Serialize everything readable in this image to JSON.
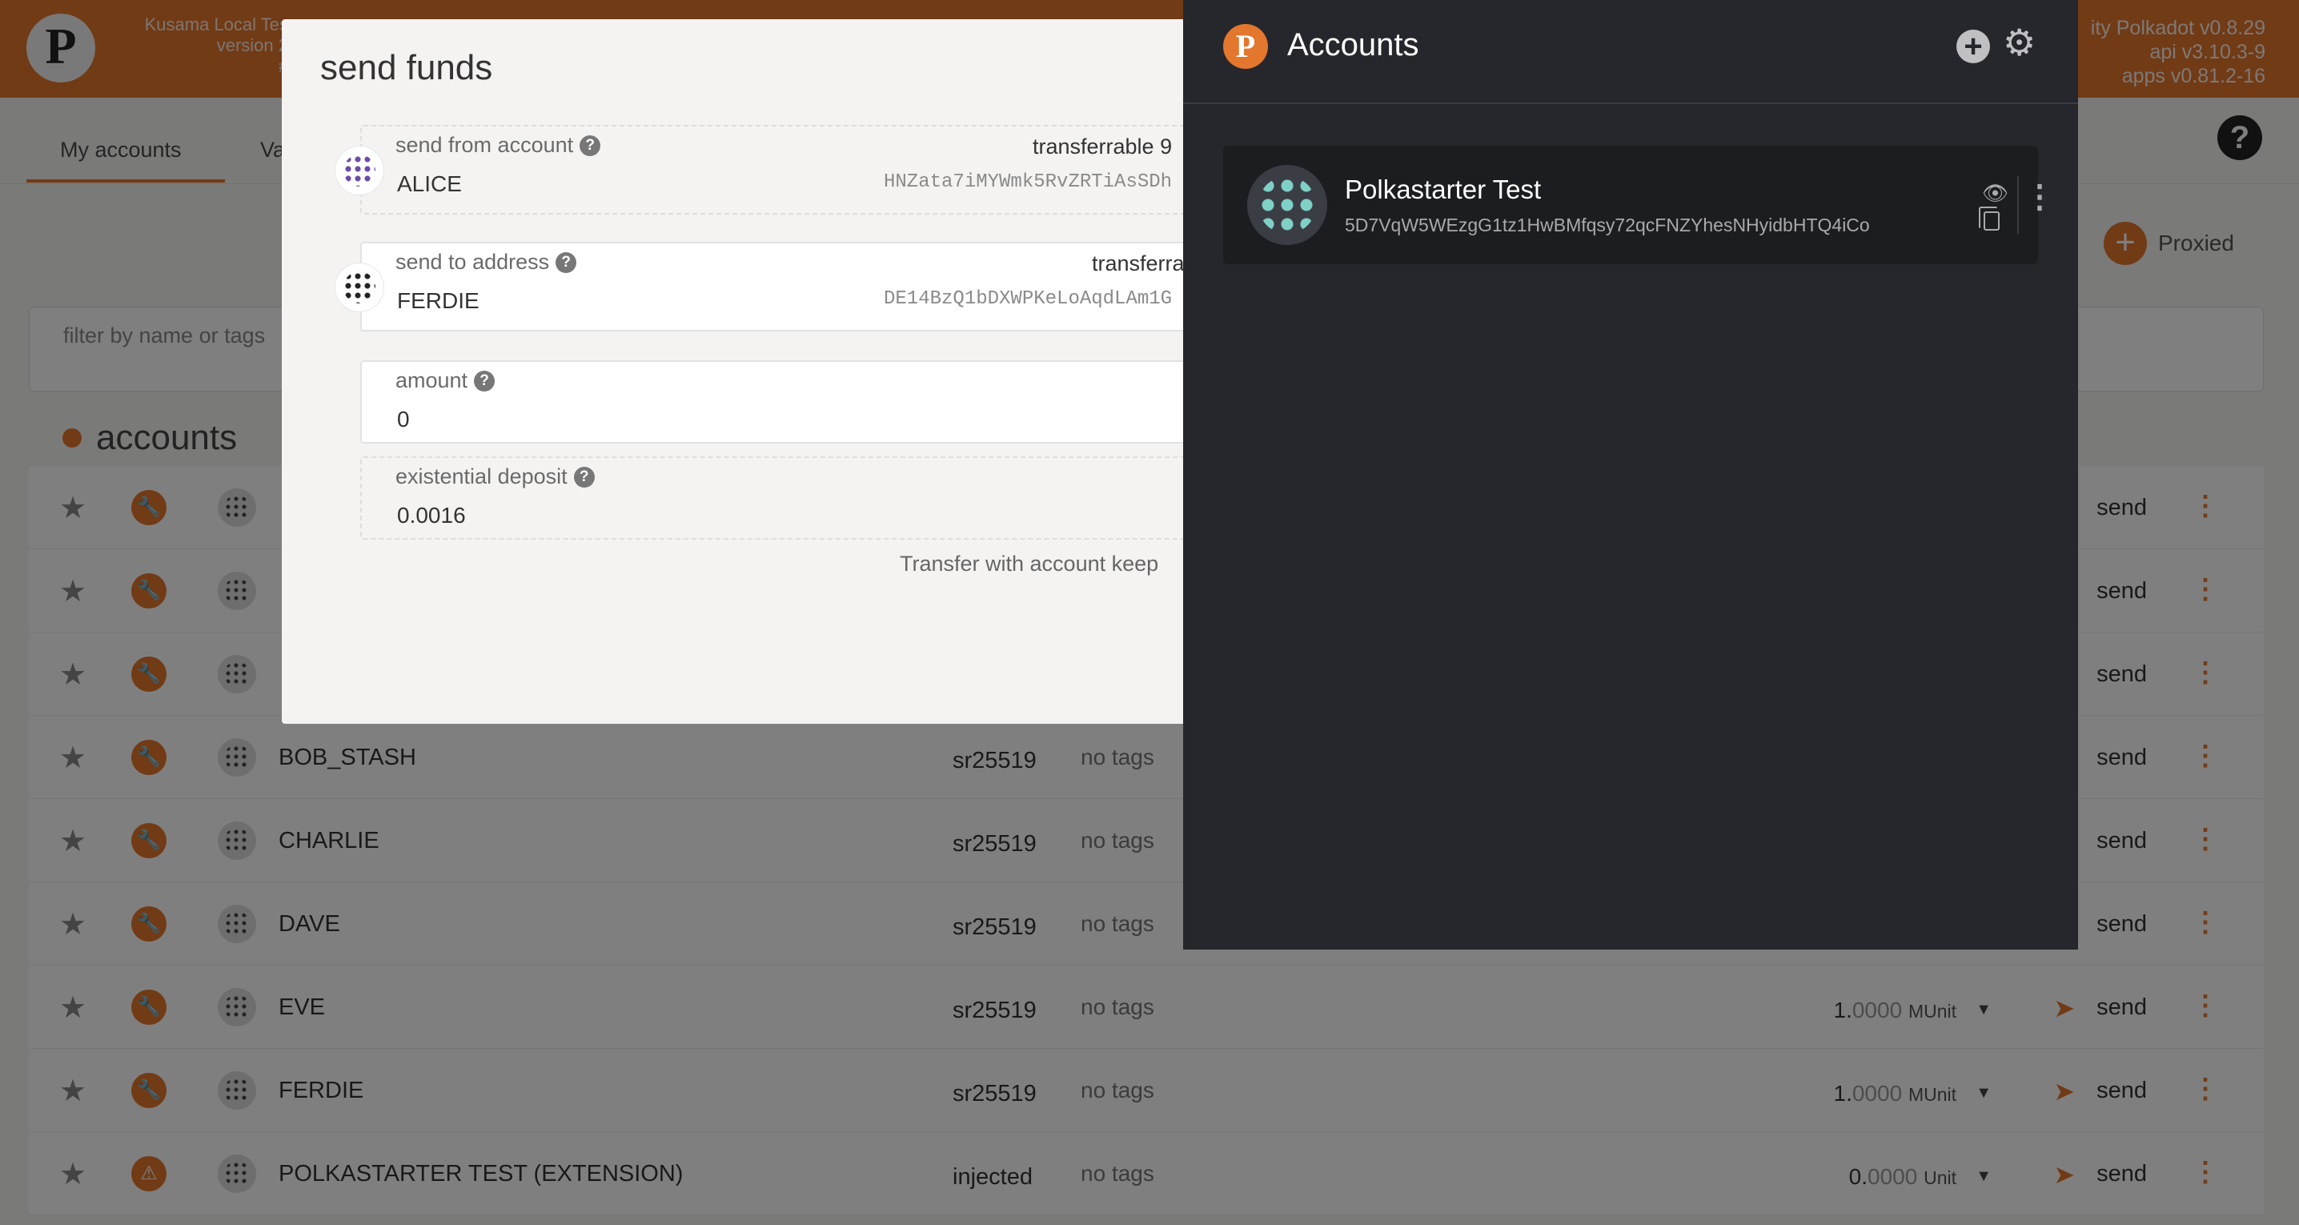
{
  "app": {
    "chain_info": [
      "Kusama Local Tes",
      "version 2",
      "#"
    ],
    "version_info": [
      "ity Polkadot v0.8.29",
      "api v3.10.3-9",
      "apps v0.81.2-16"
    ]
  },
  "tabs": [
    {
      "label": "My accounts"
    },
    {
      "label": "Va"
    }
  ],
  "header": {
    "proxied_label": "Proxied",
    "filter_placeholder": "filter by name or tags",
    "section_title": "accounts"
  },
  "rows": [
    {
      "name": "",
      "type": "",
      "tags": "",
      "balance_int": "",
      "balance_dec": "",
      "balance_unit": "",
      "send": "send"
    },
    {
      "name": "",
      "type": "",
      "tags": "",
      "balance_int": "",
      "balance_dec": "",
      "balance_unit": "",
      "send": "send"
    },
    {
      "name": "",
      "type": "",
      "tags": "",
      "balance_int": "",
      "balance_dec": "",
      "balance_unit": "",
      "send": "send"
    },
    {
      "name": "BOB_STASH",
      "type": "sr25519",
      "tags": "no tags",
      "balance_int": "",
      "balance_dec": "",
      "balance_unit": "",
      "send": "send"
    },
    {
      "name": "CHARLIE",
      "type": "sr25519",
      "tags": "no tags",
      "balance_int": "",
      "balance_dec": "",
      "balance_unit": "",
      "send": "send"
    },
    {
      "name": "DAVE",
      "type": "sr25519",
      "tags": "no tags",
      "balance_int": "",
      "balance_dec": "",
      "balance_unit": "",
      "send": "send"
    },
    {
      "name": "EVE",
      "type": "sr25519",
      "tags": "no tags",
      "balance_int": "1.",
      "balance_dec": "0000",
      "balance_unit": "MUnit",
      "send": "send"
    },
    {
      "name": "FERDIE",
      "type": "sr25519",
      "tags": "no tags",
      "balance_int": "1.",
      "balance_dec": "0000",
      "balance_unit": "MUnit",
      "send": "send"
    },
    {
      "name": "POLKASTARTER TEST (EXTENSION)",
      "type": "injected",
      "tags": "no tags",
      "balance_int": "0.",
      "balance_dec": "0000",
      "balance_unit": "Unit",
      "send": "send"
    }
  ],
  "modal": {
    "title": "send funds",
    "from": {
      "label": "send from account",
      "value": "ALICE",
      "right": "transferrable 9",
      "address": "HNZata7iMYWmk5RvZRTiAsSDh"
    },
    "to": {
      "label": "send to address",
      "value": "FERDIE",
      "right": "transferra",
      "address": "DE14BzQ1bDXWPKeLoAqdLAm1G"
    },
    "amount": {
      "label": "amount",
      "value": "0"
    },
    "deposit": {
      "label": "existential deposit",
      "value": "0.0016"
    },
    "note": "Transfer with account keep"
  },
  "extension": {
    "title": "Accounts",
    "account": {
      "name": "Polkastarter Test",
      "address": "5D7VqW5WEzgG1tz1HwBMfqsy72qcFNZYhesNHyidbHTQ4iCo"
    }
  },
  "colors": {
    "accent": "#e2772d",
    "ext_bg": "#26272c",
    "card_bg": "#1c1d21"
  }
}
